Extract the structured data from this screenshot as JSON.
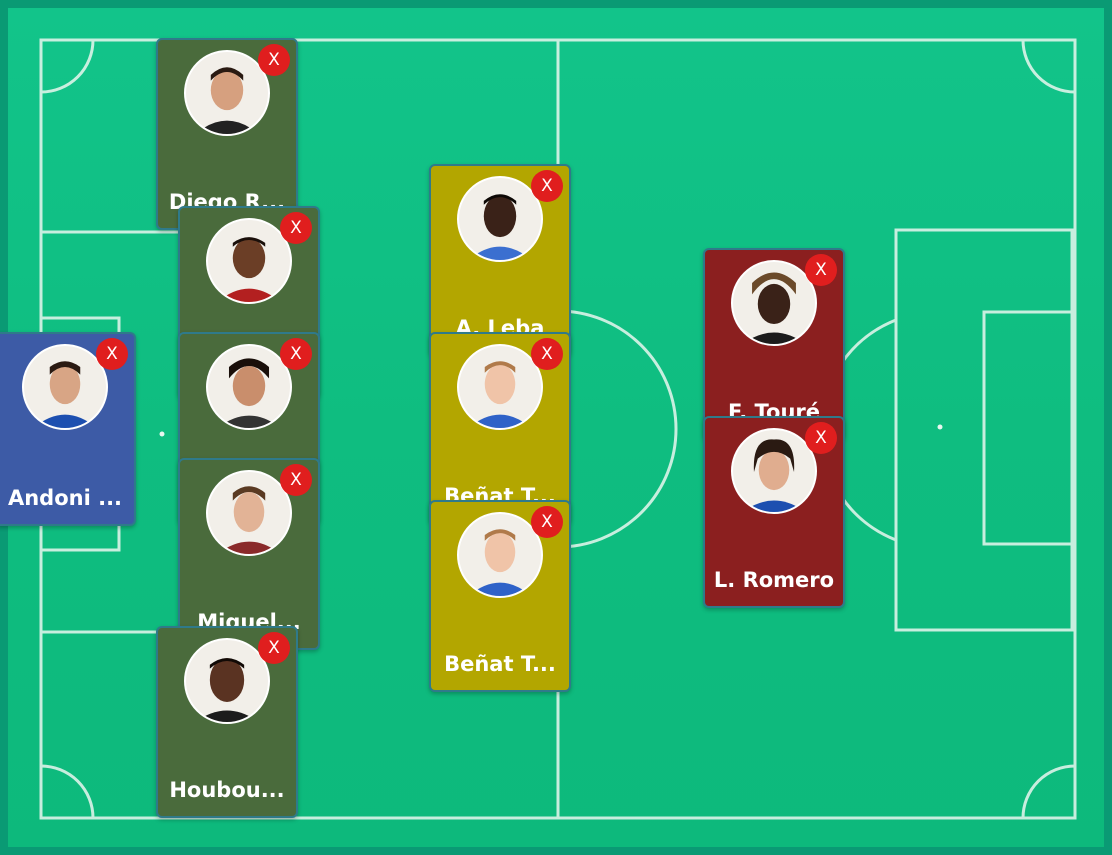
{
  "pitch": {
    "color": "#0fbd80",
    "line_color": "#ffffff"
  },
  "team_colors": {
    "defender": "#4a6b3c",
    "midfielder": "#b3a600",
    "forward": "#8b1f1f",
    "goalkeeper": "#3d5ba6",
    "remove": "#e01e1e"
  },
  "players": {
    "diego": {
      "name": "Diego R...",
      "remove": "X"
    },
    "andoni": {
      "name": "Andoni ...",
      "remove": "X"
    },
    "def2": {
      "name": "",
      "remove": "X"
    },
    "def3": {
      "name": "",
      "remove": "X"
    },
    "miguel": {
      "name": "Miguel...",
      "remove": "X"
    },
    "houbou": {
      "name": "Houbou...",
      "remove": "X"
    },
    "leba": {
      "name": "A. Leba",
      "remove": "X"
    },
    "benat1": {
      "name": "Beñat T...",
      "remove": "X"
    },
    "benat2": {
      "name": "Beñat T...",
      "remove": "X"
    },
    "toure": {
      "name": "F. Touré",
      "remove": "X"
    },
    "romero": {
      "name": "L. Romero",
      "remove": "X"
    }
  }
}
